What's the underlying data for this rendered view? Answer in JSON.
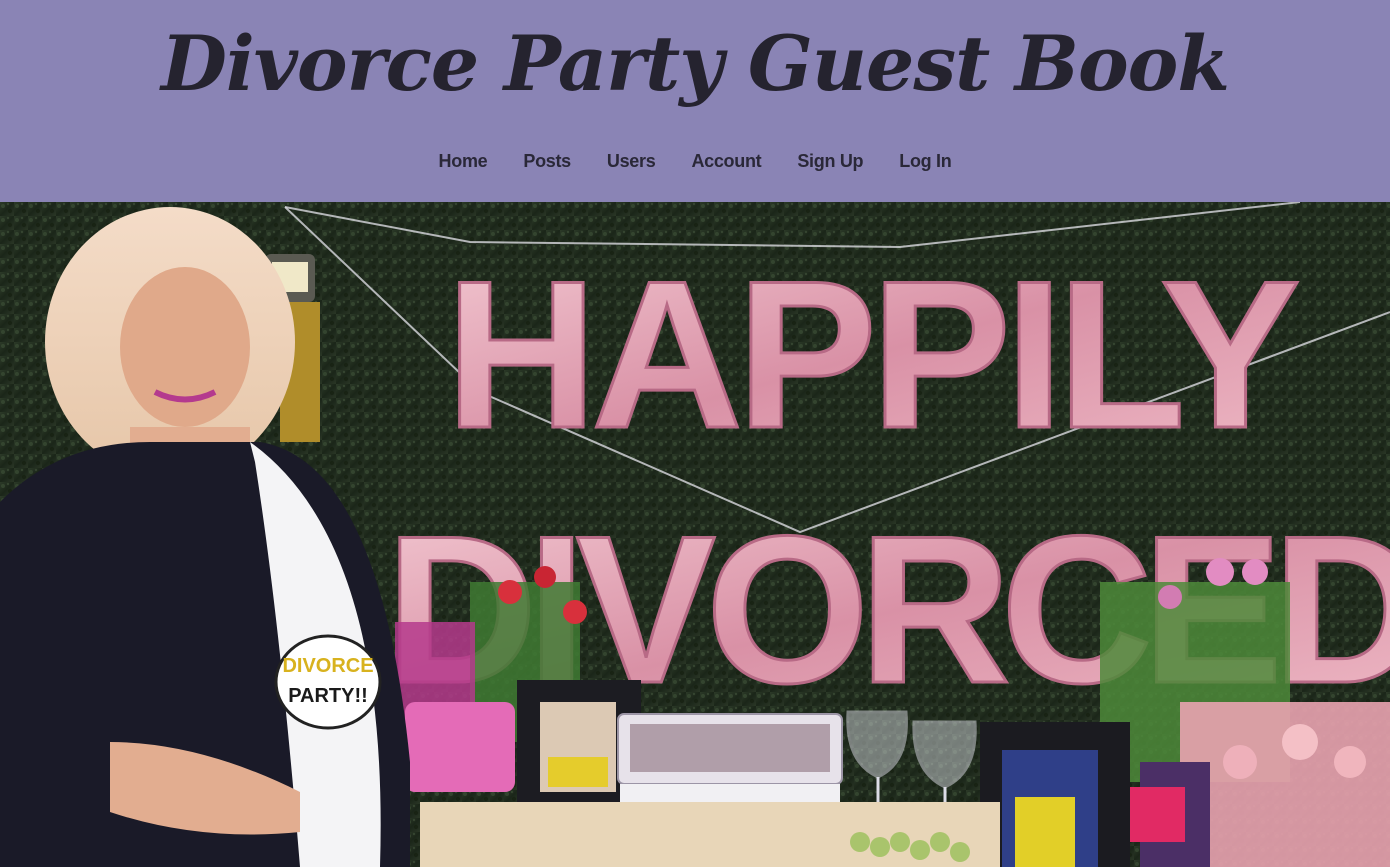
{
  "header": {
    "title": "Divorce Party Guest Book",
    "background": "#8a84b5"
  },
  "nav": {
    "items": [
      {
        "label": "Home"
      },
      {
        "label": "Posts"
      },
      {
        "label": "Users"
      },
      {
        "label": "Account"
      },
      {
        "label": "Sign Up"
      },
      {
        "label": "Log In"
      }
    ]
  },
  "hero": {
    "balloon_text_top": "HAPPILY",
    "balloon_text_bottom": "DIVORCED",
    "sign_line1": "DIVORCE",
    "sign_line2": "PARTY!!",
    "balloon_color": "#e3a9b9"
  }
}
